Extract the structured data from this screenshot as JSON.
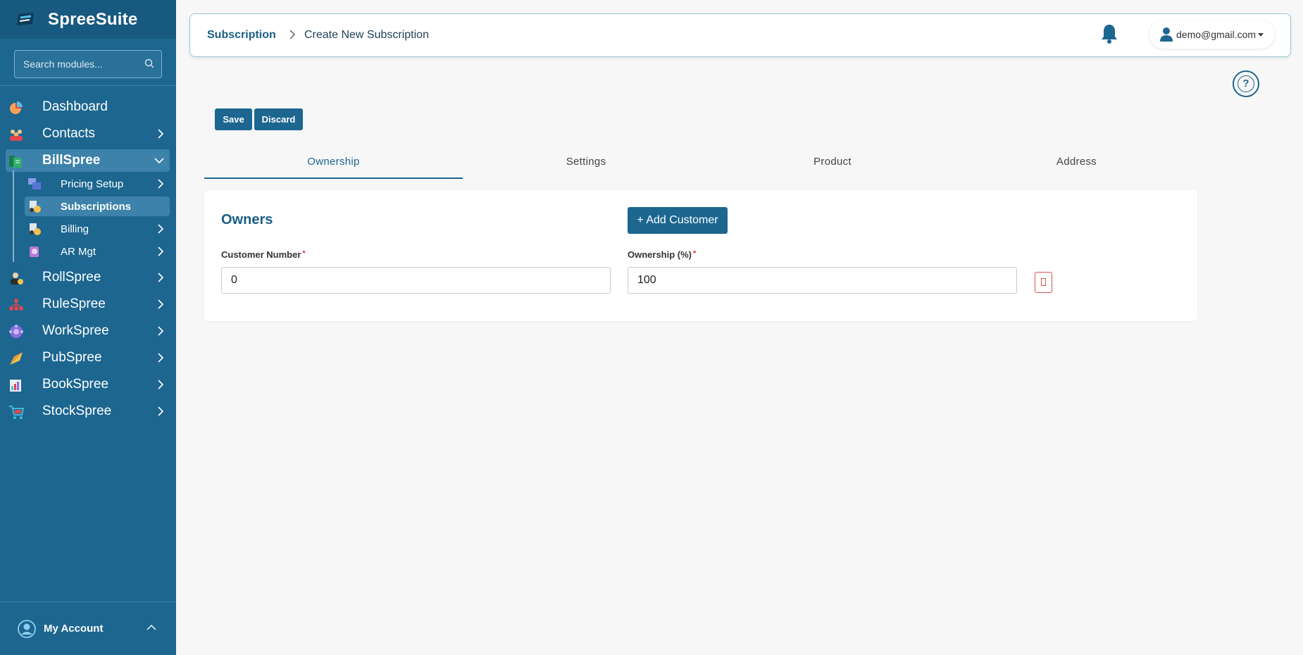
{
  "sidebar": {
    "brand": "SpreeSuite",
    "search_placeholder": "Search modules...",
    "items": [
      {
        "label": "Dashboard",
        "icon": "dashboard-pie-icon"
      },
      {
        "label": "Contacts",
        "icon": "contacts-people-icon"
      },
      {
        "label": "BillSpree",
        "icon": "billspree-icon"
      },
      {
        "label": "RollSpree",
        "icon": "rollspree-icon"
      },
      {
        "label": "RuleSpree",
        "icon": "rulespree-icon"
      },
      {
        "label": "WorkSpree",
        "icon": "workspree-icon"
      },
      {
        "label": "PubSpree",
        "icon": "pubspree-icon"
      },
      {
        "label": "BookSpree",
        "icon": "bookspree-icon"
      },
      {
        "label": "StockSpree",
        "icon": "stockspree-icon"
      }
    ],
    "sub_items": [
      {
        "label": "Pricing Setup"
      },
      {
        "label": "Subscriptions"
      },
      {
        "label": "Billing"
      },
      {
        "label": "AR Mgt"
      }
    ],
    "account_label": "My Account"
  },
  "header": {
    "breadcrumb_root": "Subscription",
    "breadcrumb_current": "Create New Subscription",
    "user_email": "demo@gmail.com"
  },
  "help_label": "?",
  "actions": {
    "save": "Save",
    "discard": "Discard"
  },
  "tabs": [
    "Ownership",
    "Settings",
    "Product",
    "Address"
  ],
  "owners": {
    "title": "Owners",
    "add_button": "+ Add Customer",
    "customer_number_label": "Customer Number",
    "customer_number_value": "0",
    "ownership_label": "Ownership (%)",
    "ownership_value": "100",
    "required_mark": "*"
  },
  "colors": {
    "sidebar_bg": "#1c6690",
    "accent": "#1c6690",
    "danger": "#d9534f"
  }
}
